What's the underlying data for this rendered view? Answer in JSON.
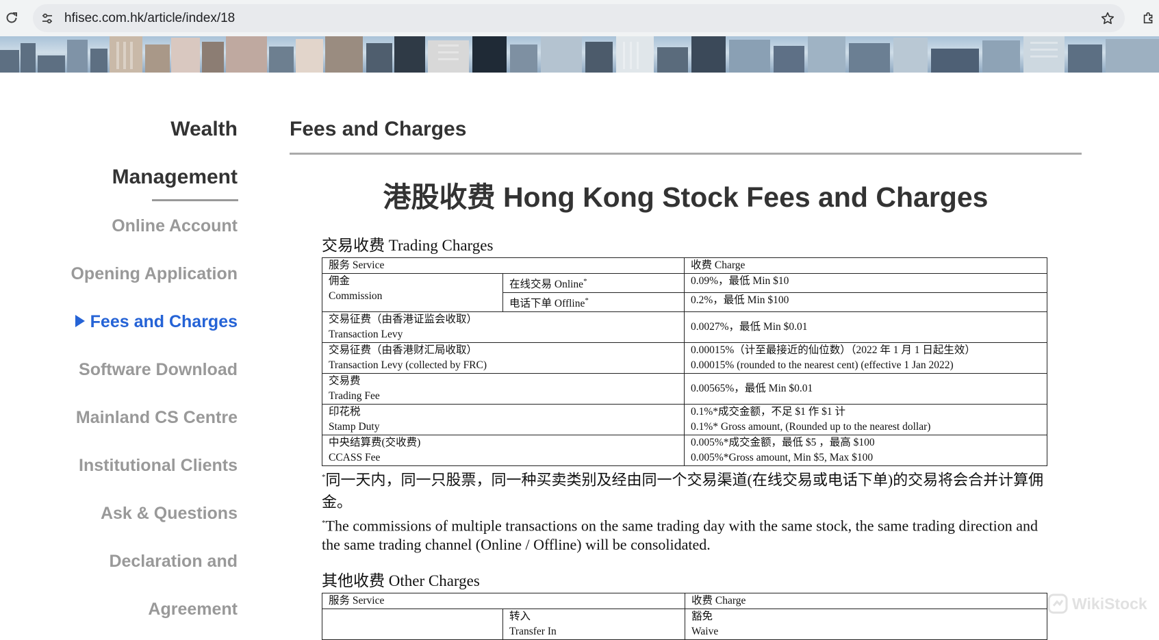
{
  "browser": {
    "url": "hfisec.com.hk/article/index/18"
  },
  "sidebar": {
    "title_line1": "Wealth",
    "title_line2": "Management",
    "items": [
      {
        "label": "Online Account"
      },
      {
        "label": "Opening Application"
      },
      {
        "label": "Fees and Charges",
        "active": true
      },
      {
        "label": "Software Download"
      },
      {
        "label": "Mainland CS Centre"
      },
      {
        "label": "Institutional Clients"
      },
      {
        "label": "Ask & Questions"
      },
      {
        "label": "Declaration and"
      },
      {
        "label": "Agreement"
      }
    ]
  },
  "main": {
    "page_title": "Fees and Charges",
    "doc_heading": "港股收费 Hong Kong Stock Fees and Charges",
    "trading": {
      "section_title": "交易收费  Trading Charges",
      "header_service": "服务 Service",
      "header_charge": "收费 Charge",
      "commission_cn": "佣金",
      "commission_en": "Commission",
      "online_label": "在线交易 Online",
      "online_charge": "0.09%，最低 Min $10",
      "offline_label": "电话下单 Offline",
      "offline_charge": "0.2%，最低 Min $100",
      "levy_cn": "交易征费（由香港证监会收取）",
      "levy_en": "Transaction Levy",
      "levy_charge": "0.0027%，最低 Min $0.01",
      "frc_cn": "交易征费（由香港财汇局收取）",
      "frc_en": "Transaction Levy (collected by FRC)",
      "frc_charge_cn": "0.00015%（计至最接近的仙位数）（2022 年 1 月 1 日起生效）",
      "frc_charge_en": "0.00015% (rounded to the nearest cent) (effective 1 Jan 2022)",
      "tfee_cn": "交易费",
      "tfee_en": "Trading Fee",
      "tfee_charge": "0.00565%，最低 Min $0.01",
      "stamp_cn": "印花税",
      "stamp_en": "Stamp Duty",
      "stamp_charge_cn": "0.1%*成交金额，不足 $1 作 $1 计",
      "stamp_charge_en": "0.1%* Gross amount, (Rounded up to the nearest dollar)",
      "ccass_cn": "中央结算费(交收费)",
      "ccass_en": "CCASS Fee",
      "ccass_charge_cn": "0.005%*成交金额，最低 $5 ，最高 $100",
      "ccass_charge_en": "0.005%*Gross amount, Min $5, Max $100"
    },
    "note_cn": "同一天内，同一只股票，同一种买卖类别及经由同一个交易渠道(在线交易或电话下单)的交易将会合并计算佣金。",
    "note_en": "The commissions of multiple transactions on the same trading day with the same stock, the same trading direction and the same trading channel (Online / Offline) will be consolidated.",
    "other": {
      "section_title": "其他收费  Other Charges",
      "header_service": "服务 Service",
      "header_charge": "收费 Charge",
      "transfer_in_cn": "转入",
      "transfer_in_en": "Transfer In",
      "transfer_in_charge_cn": "豁免",
      "transfer_in_charge_en": "Waive"
    }
  },
  "watermark": {
    "text": "WikiStock"
  }
}
